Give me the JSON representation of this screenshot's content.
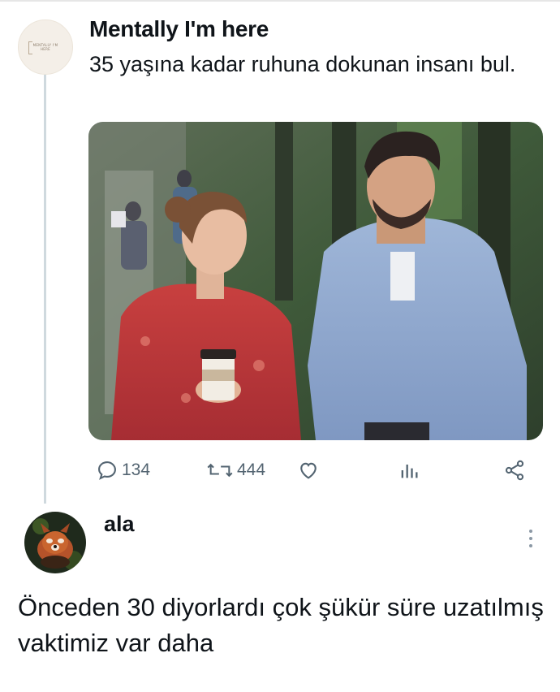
{
  "tweet": {
    "author": "Mentally I'm here",
    "avatar_text": "MENTALLY I'M HERE",
    "text": "35 yaşına kadar ruhuna dokunan insanı bul.",
    "media_description": "photo",
    "stats": {
      "replies": "134",
      "retweets": "444"
    }
  },
  "reply": {
    "author": "ala",
    "text": "Önceden 30 diyorlardı çok şükür süre uzatılmış vaktimiz var daha"
  },
  "icons": {
    "reply": "reply-icon",
    "retweet": "retweet-icon",
    "like": "heart-icon",
    "views": "views-icon",
    "share": "share-icon",
    "more": "more-vertical-icon"
  },
  "colors": {
    "text_primary": "#0f1419",
    "text_secondary": "#536471",
    "thread_line": "#cfd9de"
  }
}
